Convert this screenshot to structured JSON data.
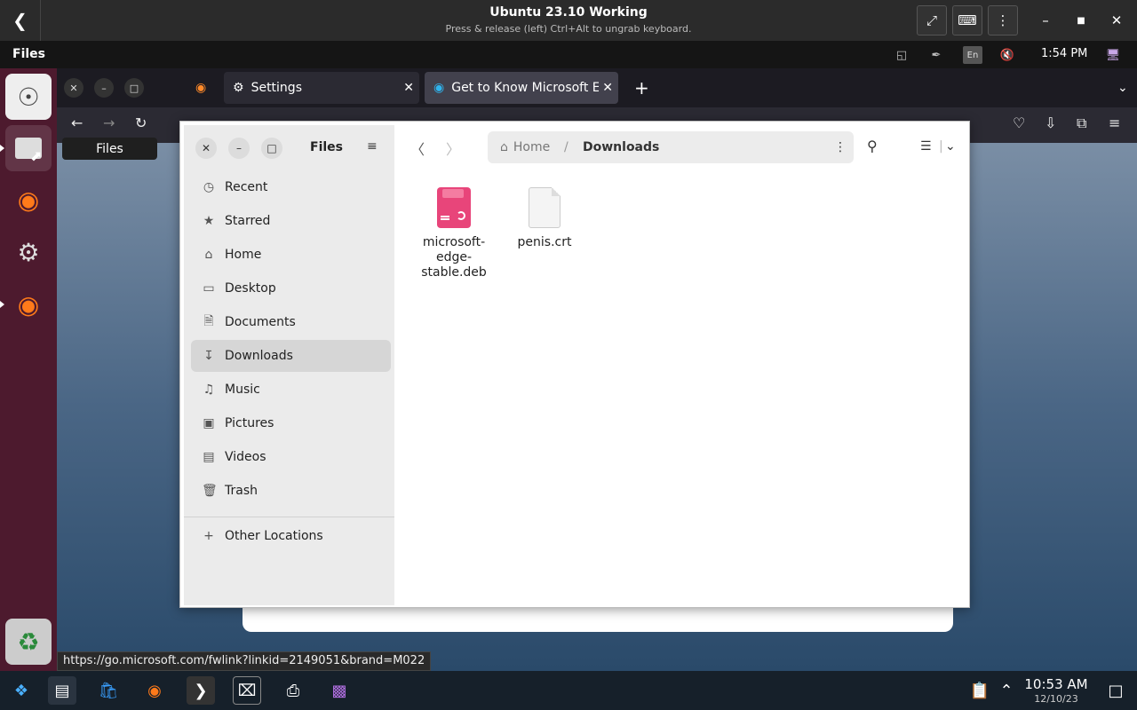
{
  "vm": {
    "title": "Ubuntu 23.10 Working",
    "subtitle": "Press & release (left) Ctrl+Alt to ungrab keyboard."
  },
  "panel": {
    "app_name": "Files",
    "lang": "En",
    "clock": "1:54 PM"
  },
  "dock": {
    "tooltip": "Files"
  },
  "firefox": {
    "tabs": [
      {
        "label": "Settings"
      },
      {
        "label": "Get to Know Microsoft Er"
      }
    ],
    "status_url": "https://go.microsoft.com/fwlink?linkid=2149051&brand=M022"
  },
  "files": {
    "sidebar_title": "Files",
    "sidebar": [
      {
        "label": "Recent",
        "icon": "clock-icon"
      },
      {
        "label": "Starred",
        "icon": "star-icon"
      },
      {
        "label": "Home",
        "icon": "home-icon"
      },
      {
        "label": "Desktop",
        "icon": "desktop-icon"
      },
      {
        "label": "Documents",
        "icon": "document-icon"
      },
      {
        "label": "Downloads",
        "icon": "download-icon",
        "selected": true
      },
      {
        "label": "Music",
        "icon": "music-icon"
      },
      {
        "label": "Pictures",
        "icon": "picture-icon"
      },
      {
        "label": "Videos",
        "icon": "video-icon"
      },
      {
        "label": "Trash",
        "icon": "trash-icon"
      }
    ],
    "other_locations": "Other Locations",
    "path": {
      "home": "Home",
      "separator": "/",
      "current": "Downloads"
    },
    "items": [
      {
        "name": "microsoft-edge-stable.deb",
        "type": "deb"
      },
      {
        "name": "penis.crt",
        "type": "text"
      }
    ]
  },
  "taskbar": {
    "clock": "10:53 AM",
    "date": "12/10/23"
  }
}
